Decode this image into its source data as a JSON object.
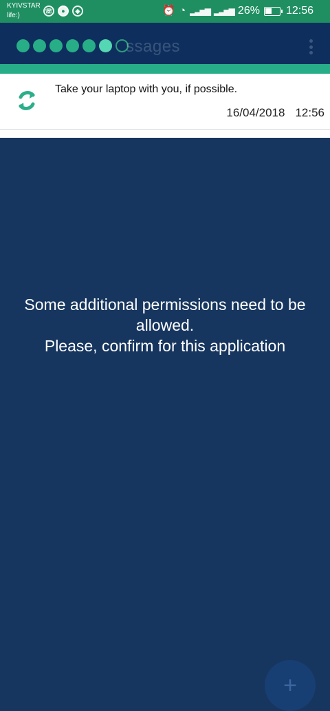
{
  "status_bar": {
    "carrier_top": "KYIVSTAR",
    "carrier_bottom": "life:)",
    "left_icons": [
      "viber-icon",
      "chat-icon",
      "shield-icon"
    ],
    "signal_icons": [
      "alarm-icon",
      "wifi-icon",
      "signal-icon",
      "signal-icon"
    ],
    "battery_percent": "26%",
    "time": "12:56"
  },
  "app_header": {
    "title_partial": "ssages",
    "pager_dots": 7,
    "accent_color": "#28ae86"
  },
  "message": {
    "text": "Take your laptop with you, if possible.",
    "date": "16/04/2018",
    "time": "12:56"
  },
  "content": {
    "line1": "Some additional permissions need to be allowed.",
    "line2": "Please, confirm for this application"
  },
  "fab": {
    "label": "+"
  },
  "colors": {
    "status": "#1f8f62",
    "header": "#0e2f5e",
    "body": "#17365f",
    "teal": "#27ad88"
  }
}
